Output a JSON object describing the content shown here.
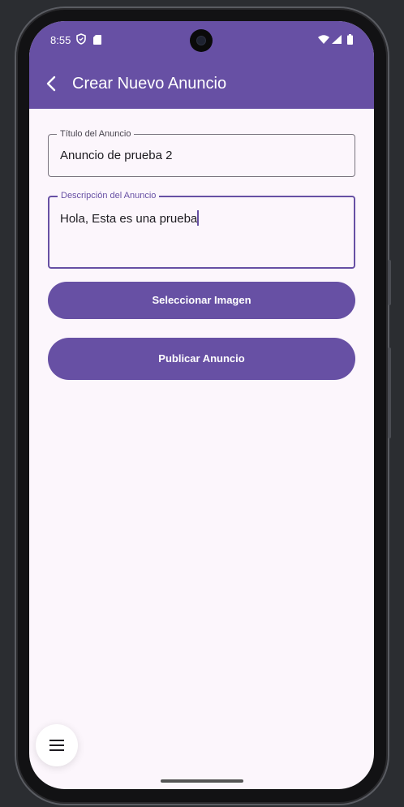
{
  "status_bar": {
    "time": "8:55"
  },
  "app_bar": {
    "title": "Crear Nuevo Anuncio"
  },
  "form": {
    "title_field": {
      "label": "Título del Anuncio",
      "value": "Anuncio de prueba 2"
    },
    "description_field": {
      "label": "Descripción del Anuncio",
      "value": "Hola, Esta es una prueba"
    }
  },
  "buttons": {
    "select_image": "Seleccionar Imagen",
    "publish": "Publicar Anuncio"
  },
  "icons": {
    "back": "arrow-back-icon",
    "fab": "menu-icon",
    "status": [
      "shield-icon",
      "sd-card-icon",
      "wifi-icon",
      "signal-icon",
      "battery-icon"
    ]
  },
  "colors": {
    "primary": "#6750a4",
    "surface": "#fcf6fc",
    "on_primary": "#ffffff"
  }
}
